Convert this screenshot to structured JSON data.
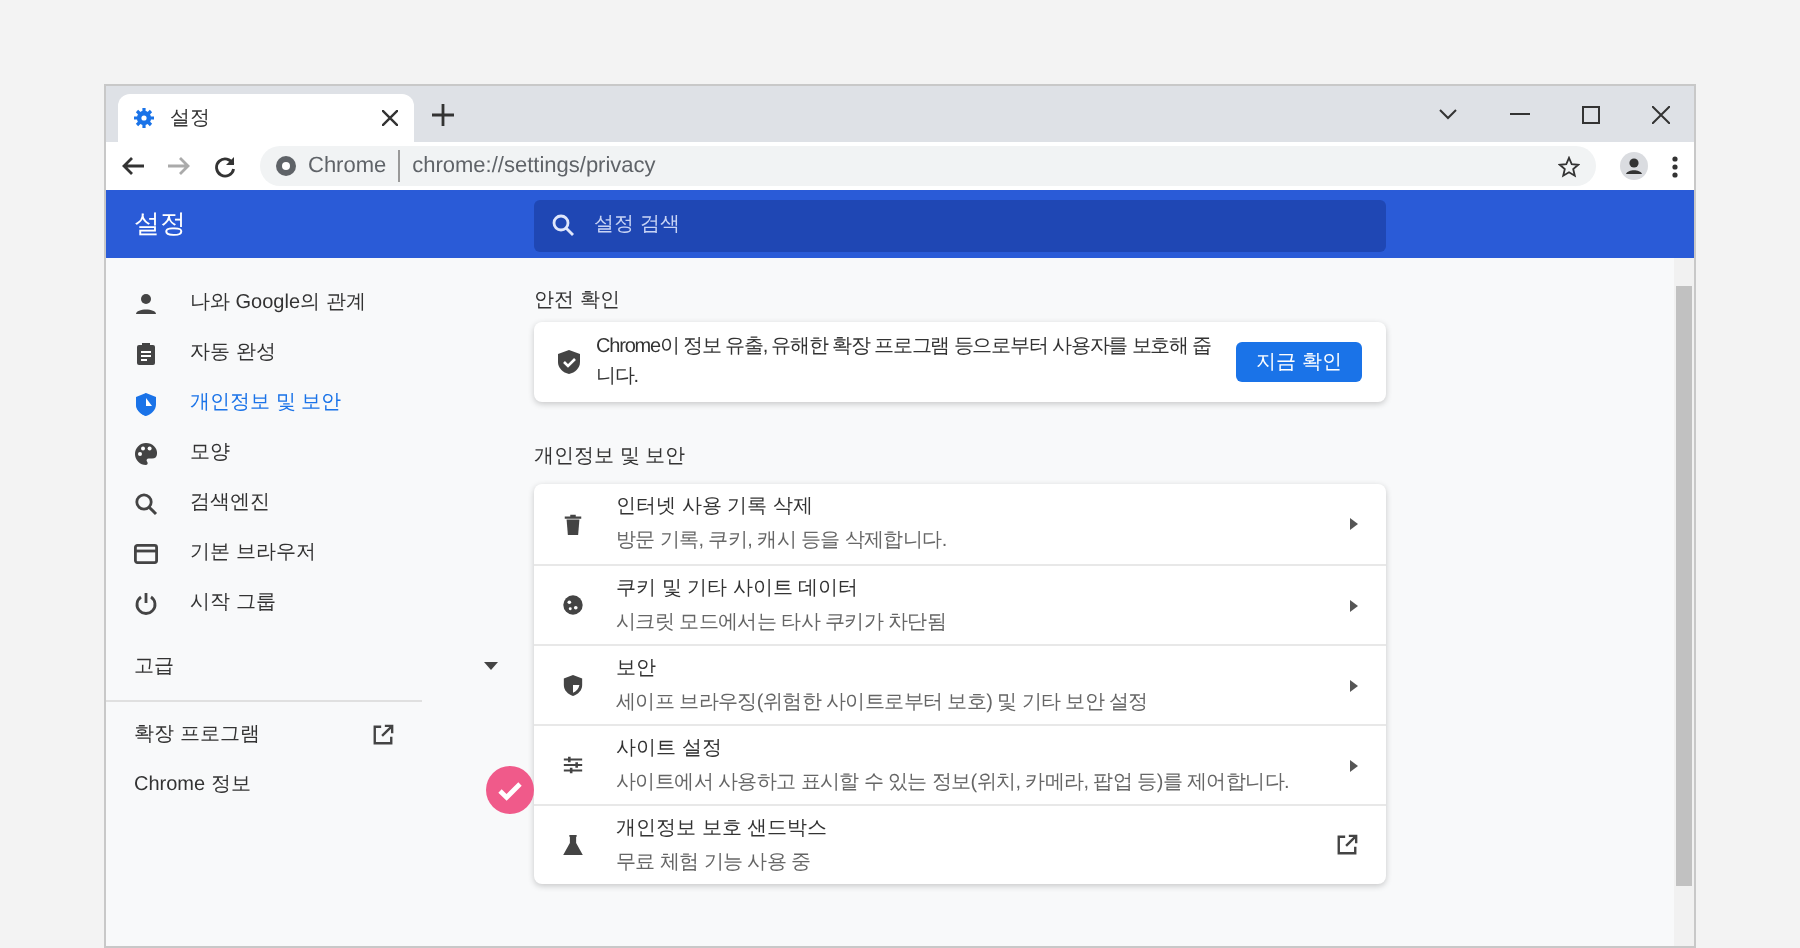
{
  "tabs": [
    {
      "title": "설정",
      "selected": true
    }
  ],
  "address_bar": {
    "site_label": "Chrome",
    "url": "chrome://settings/privacy"
  },
  "header": {
    "title": "설정",
    "search_placeholder": "설정 검색"
  },
  "sidebar": {
    "items": [
      {
        "label": "나와 Google의 관계",
        "selected": false
      },
      {
        "label": "자동 완성",
        "selected": false
      },
      {
        "label": "개인정보 및 보안",
        "selected": true
      },
      {
        "label": "모양",
        "selected": false
      },
      {
        "label": "검색엔진",
        "selected": false
      },
      {
        "label": "기본 브라우저",
        "selected": false
      },
      {
        "label": "시작 그룹",
        "selected": false
      }
    ],
    "advanced": {
      "label": "고급",
      "expanded": false
    },
    "footer_items": [
      {
        "label": "확장 프로그램",
        "kind": "external"
      },
      {
        "label": "Chrome 정보",
        "kind": "plain"
      }
    ]
  },
  "safety_check": {
    "heading": "안전 확인",
    "message": "Chrome이 정보 유출, 유해한 확장 프로그램 등으로부터 사용자를 보호해 줍니다.",
    "button": "지금 확인"
  },
  "privacy": {
    "heading": "개인정보 및 보안",
    "rows": [
      {
        "title": "인터넷 사용 기록 삭제",
        "subtitle": "방문 기록, 쿠키, 캐시 등을 삭제합니다.",
        "kind": "arrow"
      },
      {
        "title": "쿠키 및 기타 사이트 데이터",
        "subtitle": "시크릿 모드에서는 타사 쿠키가 차단됨",
        "kind": "arrow"
      },
      {
        "title": "보안",
        "subtitle": "세이프 브라우징(위험한 사이트로부터 보호) 및 기타 보안 설정",
        "kind": "arrow"
      },
      {
        "title": "사이트 설정",
        "subtitle": "사이트에서 사용하고 표시할 수 있는 정보(위치, 카메라, 팝업 등)를 제어합니다.",
        "kind": "arrow"
      },
      {
        "title": "개인정보 보호 샌드박스",
        "subtitle": "무료 체험 기능 사용 중",
        "kind": "external"
      }
    ]
  }
}
